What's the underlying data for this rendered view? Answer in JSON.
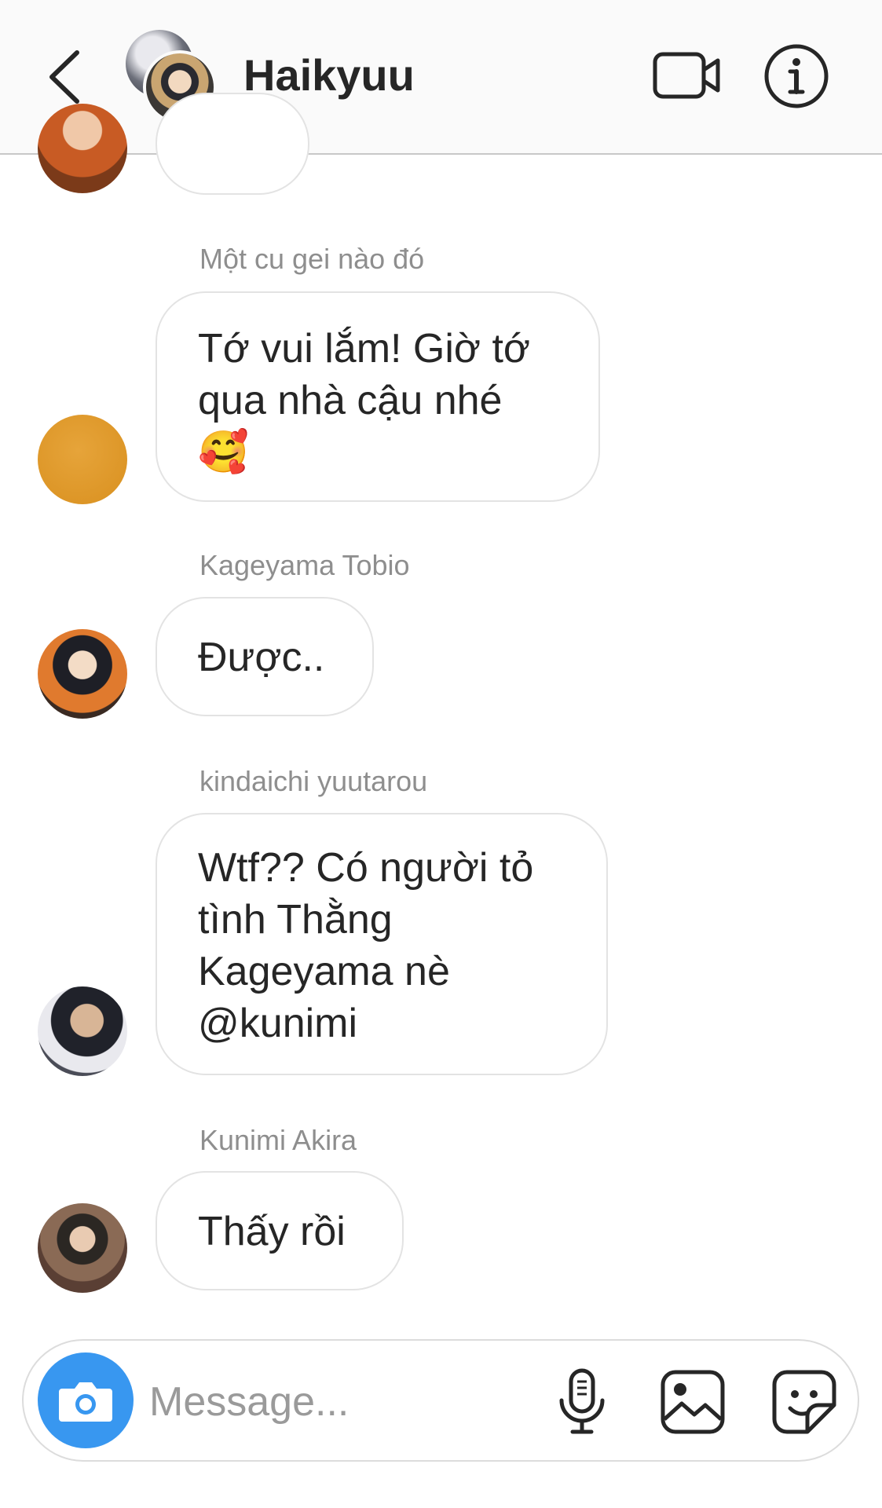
{
  "header": {
    "title": "Haikyuu",
    "icons": {
      "back": "chevron-left-icon",
      "video": "video-camera-icon",
      "info": "info-icon"
    }
  },
  "messages": [
    {
      "sender": "",
      "text": ""
    },
    {
      "sender": "Một cu gei nào đó",
      "lines": [
        "Tớ vui lắm! Giờ tớ",
        "qua nhà cậu nhé",
        "🥰"
      ]
    },
    {
      "sender": "Kageyama Tobio",
      "lines": [
        "Được.."
      ]
    },
    {
      "sender": "kindaichi yuutarou",
      "lines": [
        "Wtf?? Có người tỏ",
        "tình Thằng",
        "Kageyama nè",
        "@kunimi"
      ]
    },
    {
      "sender": "Kunimi Akira",
      "lines": [
        "Thấy rồi"
      ]
    }
  ],
  "composer": {
    "placeholder": "Message...",
    "value": "",
    "icons": {
      "camera": "camera-icon",
      "mic": "microphone-icon",
      "gallery": "gallery-icon",
      "sticker": "sticker-icon"
    },
    "accent_color": "#3897f0"
  }
}
